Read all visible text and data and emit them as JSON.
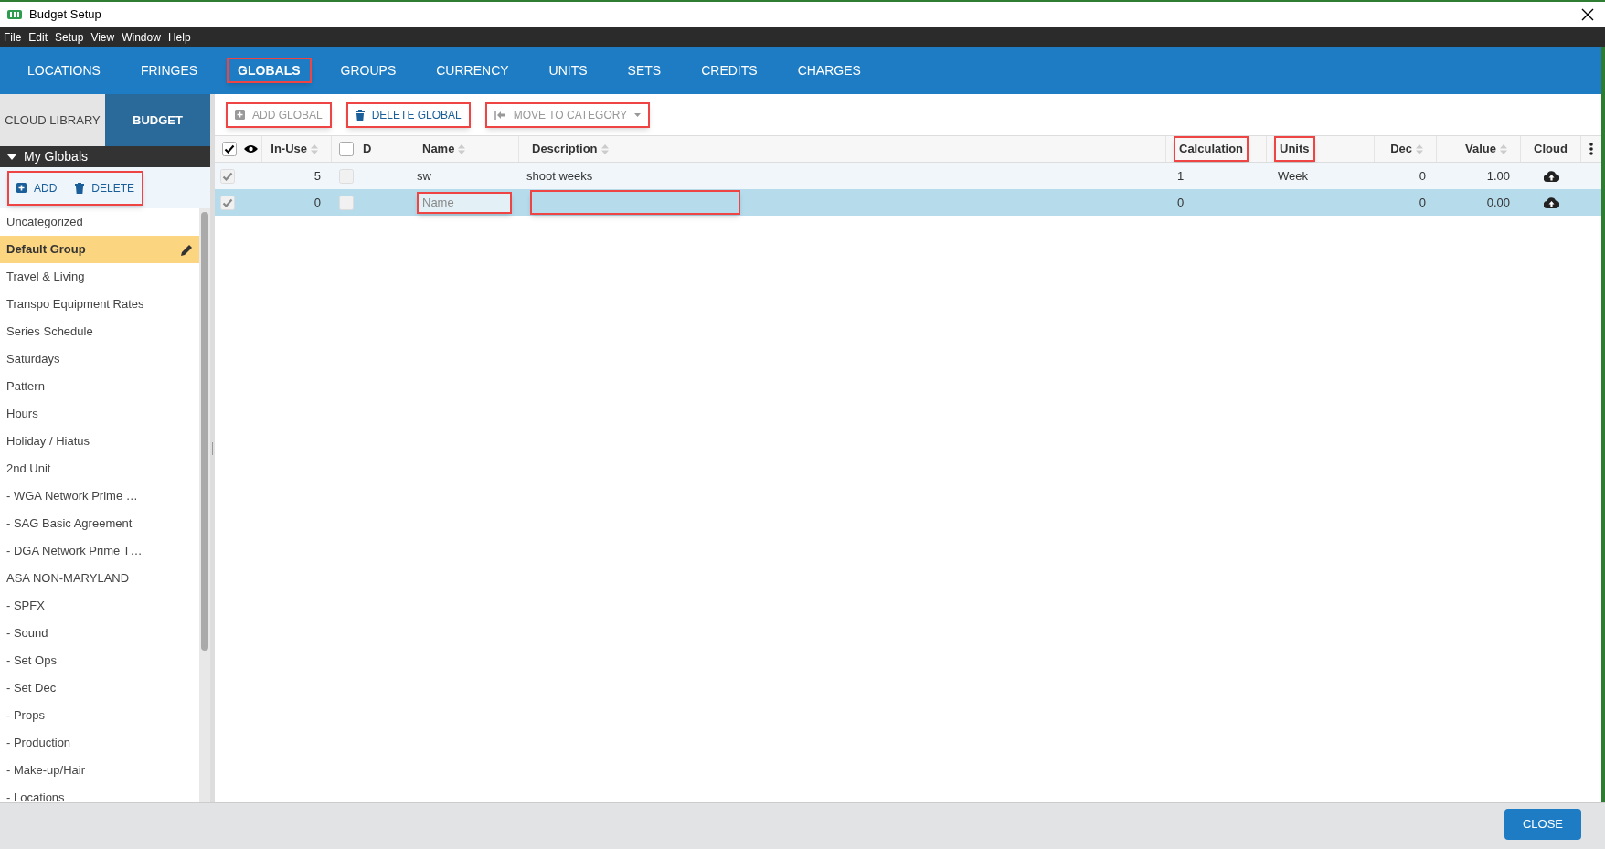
{
  "window": {
    "title": "Budget Setup"
  },
  "menu": [
    "File",
    "Edit",
    "Setup",
    "View",
    "Window",
    "Help"
  ],
  "tabs": [
    {
      "label": "LOCATIONS",
      "selected": false,
      "highlighted": false
    },
    {
      "label": "FRINGES",
      "selected": false,
      "highlighted": false
    },
    {
      "label": "GLOBALS",
      "selected": true,
      "highlighted": true
    },
    {
      "label": "GROUPS",
      "selected": false,
      "highlighted": false
    },
    {
      "label": "CURRENCY",
      "selected": false,
      "highlighted": false
    },
    {
      "label": "UNITS",
      "selected": false,
      "highlighted": false
    },
    {
      "label": "SETS",
      "selected": false,
      "highlighted": false
    },
    {
      "label": "CREDITS",
      "selected": false,
      "highlighted": false
    },
    {
      "label": "CHARGES",
      "selected": false,
      "highlighted": false
    }
  ],
  "breadcrumb": [
    {
      "label": "CLOUD LIBRARY",
      "selected": false
    },
    {
      "label": "BUDGET",
      "selected": true
    }
  ],
  "sidebar": {
    "header": "My Globals",
    "expanded": true,
    "actions_highlighted": true,
    "actions": [
      {
        "label": "ADD",
        "kind": "add"
      },
      {
        "label": "DELETE",
        "kind": "delete"
      }
    ],
    "items": [
      {
        "label": "Uncategorized",
        "selected": false
      },
      {
        "label": "Default Group",
        "selected": true
      },
      {
        "label": "Travel & Living",
        "selected": false
      },
      {
        "label": "Transpo Equipment Rates",
        "selected": false
      },
      {
        "label": "Series Schedule",
        "selected": false
      },
      {
        "label": "Saturdays",
        "selected": false
      },
      {
        "label": "Pattern",
        "selected": false
      },
      {
        "label": "Hours",
        "selected": false
      },
      {
        "label": "Holiday / Hiatus",
        "selected": false
      },
      {
        "label": "2nd Unit",
        "selected": false
      },
      {
        "label": "- WGA Network Prime …",
        "selected": false
      },
      {
        "label": "- SAG Basic Agreement",
        "selected": false
      },
      {
        "label": "- DGA Network Prime T…",
        "selected": false
      },
      {
        "label": "ASA NON-MARYLAND",
        "selected": false
      },
      {
        "label": "- SPFX",
        "selected": false
      },
      {
        "label": "- Sound",
        "selected": false
      },
      {
        "label": "- Set Ops",
        "selected": false
      },
      {
        "label": "- Set Dec",
        "selected": false
      },
      {
        "label": "- Props",
        "selected": false
      },
      {
        "label": "- Production",
        "selected": false
      },
      {
        "label": "- Make-up/Hair",
        "selected": false
      },
      {
        "label": "- Locations",
        "selected": false
      }
    ]
  },
  "toolbar": [
    {
      "label": "ADD GLOBAL",
      "kind": "add",
      "disabled": true,
      "highlighted": true
    },
    {
      "label": "DELETE GLOBAL",
      "kind": "delete",
      "disabled": false,
      "highlighted": true
    },
    {
      "label": "MOVE TO CATEGORY",
      "kind": "move",
      "disabled": true,
      "highlighted": true
    }
  ],
  "table": {
    "all_checked": true,
    "d_checked": false,
    "columns": [
      {
        "label": "In-Use",
        "sortable": true,
        "highlighted": false
      },
      {
        "label": "D",
        "sortable": false,
        "highlighted": false
      },
      {
        "label": "Name",
        "sortable": true,
        "highlighted": false
      },
      {
        "label": "Description",
        "sortable": true,
        "highlighted": false
      },
      {
        "label": "Calculation",
        "sortable": false,
        "highlighted": true
      },
      {
        "label": "Units",
        "sortable": false,
        "highlighted": true
      },
      {
        "label": "Dec",
        "sortable": true,
        "highlighted": false
      },
      {
        "label": "Value",
        "sortable": true,
        "highlighted": false
      },
      {
        "label": "Cloud",
        "sortable": false,
        "highlighted": false
      }
    ],
    "rows": [
      {
        "checked": true,
        "selected": false,
        "in_use": "5",
        "d": false,
        "name": "sw",
        "description": "shoot weeks",
        "calculation": "1",
        "units": "Week",
        "dec": "0",
        "value": "1.00",
        "editing": false
      },
      {
        "checked": true,
        "selected": true,
        "in_use": "0",
        "d": false,
        "name_placeholder": "Name",
        "calculation": "0",
        "dec": "0",
        "value": "0.00",
        "editing": true
      }
    ]
  },
  "footer": {
    "button": "CLOSE"
  }
}
